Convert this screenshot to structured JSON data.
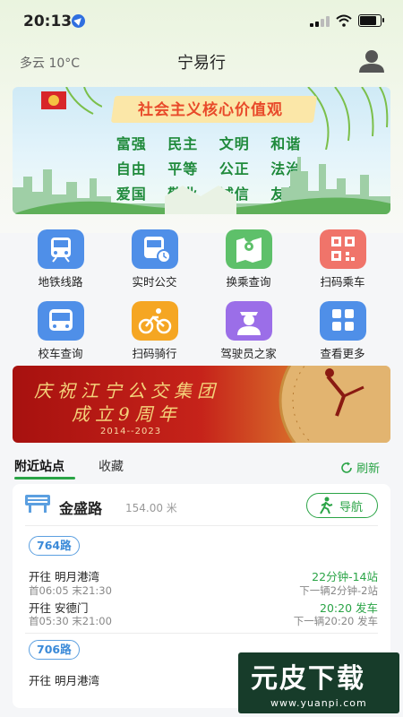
{
  "status_bar": {
    "time": "20:13"
  },
  "header": {
    "weather": "多云 10°C",
    "title": "宁易行"
  },
  "banner": {
    "title": "社会主义核心价值观",
    "values": [
      "富强",
      "民主",
      "文明",
      "和谐",
      "自由",
      "平等",
      "公正",
      "法治",
      "爱国",
      "敬业",
      "诚信",
      "友善"
    ]
  },
  "services": [
    {
      "label": "地铁线路",
      "icon": "metro-icon",
      "color": "#4f8fe8"
    },
    {
      "label": "实时公交",
      "icon": "bus-icon",
      "color": "#4f8fe8"
    },
    {
      "label": "换乘查询",
      "icon": "transfer-map-icon",
      "color": "#5ec06a"
    },
    {
      "label": "扫码乘车",
      "icon": "qr-code-icon",
      "color": "#f0746a"
    },
    {
      "label": "校车查询",
      "icon": "school-bus-icon",
      "color": "#4f8fe8"
    },
    {
      "label": "扫码骑行",
      "icon": "bicycle-icon",
      "color": "#f5a623"
    },
    {
      "label": "驾驶员之家",
      "icon": "driver-icon",
      "color": "#9b6ee8"
    },
    {
      "label": "查看更多",
      "icon": "more-icon",
      "color": "#4f8fe8"
    }
  ],
  "ad": {
    "line1": "庆祝江宁公交集团",
    "line2": "成立9周年",
    "years": "2014--2023"
  },
  "tabs": {
    "nearby": "附近站点",
    "favorites": "收藏",
    "refresh": "刷新"
  },
  "station": {
    "name": "金盛路",
    "distance": "154.00 米",
    "nav": "导航"
  },
  "routes": [
    {
      "name": "764路",
      "lines": [
        {
          "dest": "开往 明月港湾",
          "times": "首06:05 末21:30",
          "eta": "22分钟-14站",
          "next": "下一辆2分钟-2站"
        },
        {
          "dest": "开往 安德门",
          "times": "首05:30 末21:00",
          "eta": "20:20 发车",
          "next": "下一辆20:20 发车"
        }
      ]
    },
    {
      "name": "706路",
      "lines": [
        {
          "dest": "开往 明月港湾",
          "times": "",
          "eta": "",
          "next": ""
        }
      ]
    }
  ],
  "watermark": {
    "text": "元皮下载",
    "url": "www.yuanpi.com"
  },
  "colors": {
    "accent": "#2aa446",
    "route_blue": "#3b8ad8",
    "ad_red": "#c6231a"
  }
}
